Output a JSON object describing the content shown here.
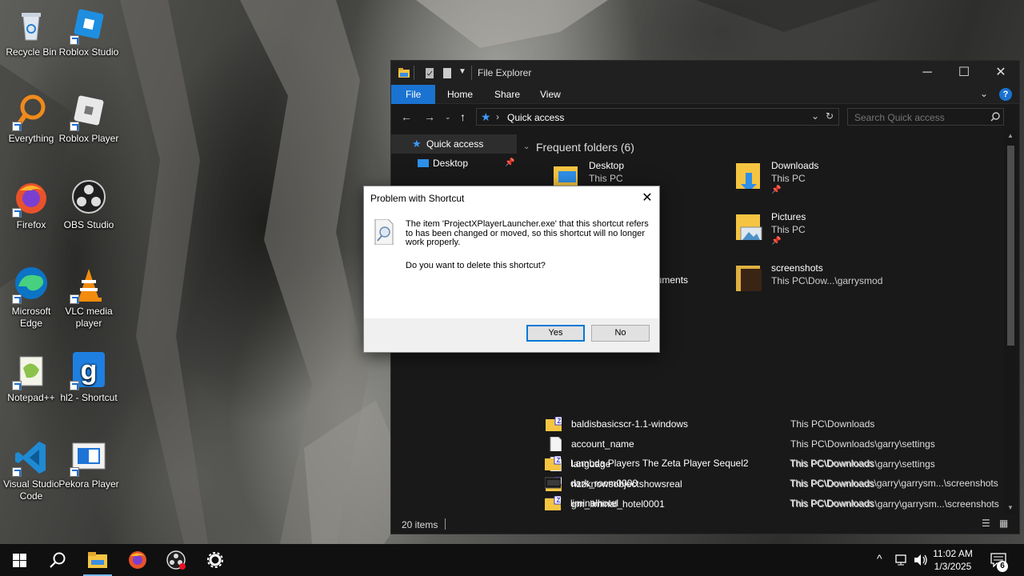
{
  "desktop": {
    "icons": [
      {
        "label": "Recycle Bin"
      },
      {
        "label": "Roblox Studio"
      },
      {
        "label": "Everything"
      },
      {
        "label": "Roblox Player"
      },
      {
        "label": "Firefox"
      },
      {
        "label": "OBS Studio"
      },
      {
        "label": "Microsoft Edge"
      },
      {
        "label": "VLC media player"
      },
      {
        "label": "Notepad++"
      },
      {
        "label": "hl2 - Shortcut"
      },
      {
        "label": "Visual Studio Code"
      },
      {
        "label": "Pekora Player"
      }
    ]
  },
  "explorer": {
    "title": "File Explorer",
    "tabs": [
      "File",
      "Home",
      "Share",
      "View"
    ],
    "address": {
      "crumb": "Quick access"
    },
    "search": {
      "placeholder": "Search Quick access"
    },
    "nav": {
      "quick_access": "Quick access",
      "desktop": "Desktop"
    },
    "frequent_header": "Frequent folders (6)",
    "frequent": [
      {
        "name": "Desktop",
        "path": "This PC",
        "pinned": true
      },
      {
        "name": "Downloads",
        "path": "This PC",
        "pinned": true
      },
      {
        "name": "Pictures",
        "path": "This PC",
        "pinned": true
      },
      {
        "name": "screenshots",
        "path": "This PC\\Dow...\\garrysmod",
        "pinned": false
      },
      {
        "name": "",
        "path": "ocuments",
        "pinned": false
      }
    ],
    "recent": [
      {
        "name": "baldisbasicscr-1.1-windows",
        "location": "This PC\\Downloads",
        "type": "zip"
      },
      {
        "name": "account_name",
        "location": "This PC\\Downloads\\garry\\settings",
        "type": "file"
      },
      {
        "name": "language",
        "location": "This PC\\Downloads\\garry\\settings",
        "type": "file"
      },
      {
        "name": "rizzknowsobjectshowsreal",
        "location": "This PC\\Downloads",
        "type": "zip"
      },
      {
        "name": "gm_liminal_hotel0001",
        "location": "This PC\\Downloads\\garry\\garrysm...\\screenshots",
        "type": "image"
      },
      {
        "name": "Lambda Players The Zeta Player Sequel2",
        "location": "This PC\\Downloads",
        "type": "zip"
      },
      {
        "name": "dark_room0000",
        "location": "This PC\\Downloads\\garry\\garrysm...\\screenshots",
        "type": "image"
      },
      {
        "name": "liminalhotel",
        "location": "This PC\\Downloads",
        "type": "zip"
      }
    ],
    "status": {
      "count": "20 items"
    }
  },
  "dialog": {
    "title": "Problem with Shortcut",
    "message": "The item 'ProjectXPlayerLauncher.exe' that this shortcut refers to has been changed or moved, so this shortcut will no longer work properly.",
    "question": "Do you want to delete this shortcut?",
    "yes": "Yes",
    "no": "No"
  },
  "taskbar": {
    "time": "11:02 AM",
    "date": "1/3/2025",
    "notifications": "6"
  },
  "colors": {
    "accent": "#1a73d1",
    "folder": "#f5c542"
  }
}
